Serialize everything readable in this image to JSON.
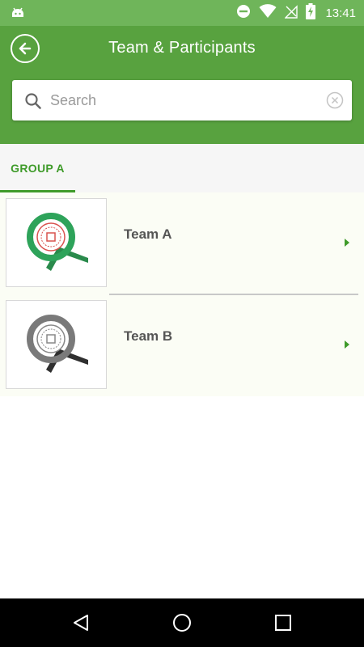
{
  "status_bar": {
    "time": "13:41",
    "icons": [
      "android-icon",
      "do-not-disturb-icon",
      "wifi-icon",
      "no-sim-icon",
      "battery-charging-icon"
    ]
  },
  "app_bar": {
    "title": "Team & Participants",
    "back_icon": "back-arrow-icon"
  },
  "search": {
    "placeholder": "Search",
    "value": ""
  },
  "tabs": [
    {
      "label": "GROUP A",
      "selected": true
    }
  ],
  "teams": [
    {
      "name": "Team A",
      "logo_color": "green"
    },
    {
      "name": "Team B",
      "logo_color": "gray"
    }
  ],
  "colors": {
    "status_bar": "#6fb55a",
    "app_bar": "#58a23f",
    "accent": "#3f9b2a",
    "list_background": "#fbfdf5",
    "team_a_ring": "#2ea35a",
    "team_a_seal": "#d9534f",
    "team_b_ring": "#7a7a7a"
  }
}
